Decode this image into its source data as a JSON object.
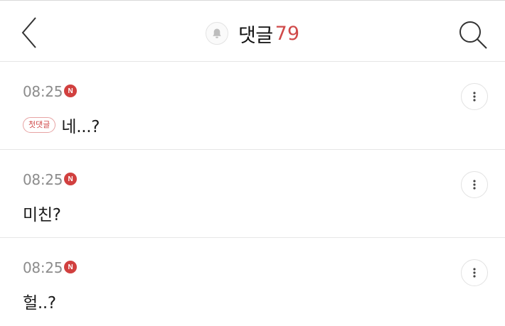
{
  "header": {
    "title": "댓글",
    "count": "79",
    "icons": {
      "back": "chevron-left-icon",
      "bell": "bell-icon",
      "search": "search-icon"
    }
  },
  "comments": [
    {
      "time": "08:25",
      "new_badge": "N",
      "first_tag": "첫댓글",
      "text": "네...?"
    },
    {
      "time": "08:25",
      "new_badge": "N",
      "text": "미친?"
    },
    {
      "time": "08:25",
      "new_badge": "N",
      "text": "헐..?"
    }
  ],
  "colors": {
    "accent": "#d04a4a",
    "badge": "#d1403f",
    "meta": "#8c8c8c",
    "divider": "#e6e6e6"
  }
}
